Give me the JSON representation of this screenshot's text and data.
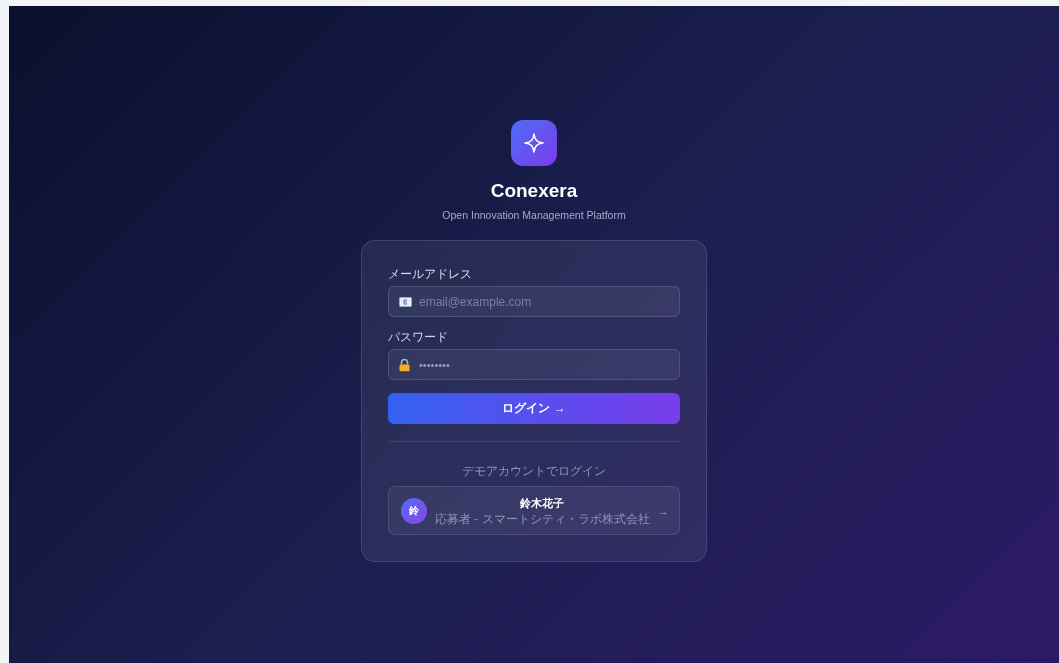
{
  "brand": {
    "name": "Conexera",
    "tagline": "Open Innovation Management Platform"
  },
  "form": {
    "email": {
      "label": "メールアドレス",
      "placeholder": "email@example.com"
    },
    "password": {
      "label": "パスワード",
      "placeholder": "••••••••"
    },
    "submit": "ログイン →"
  },
  "demo": {
    "heading": "デモアカウントでログイン",
    "accounts": [
      {
        "initial": "鈴",
        "name": "鈴木花子",
        "detail": "応募者 - スマートシティ・ラボ株式会社",
        "arrow": "→"
      }
    ]
  }
}
